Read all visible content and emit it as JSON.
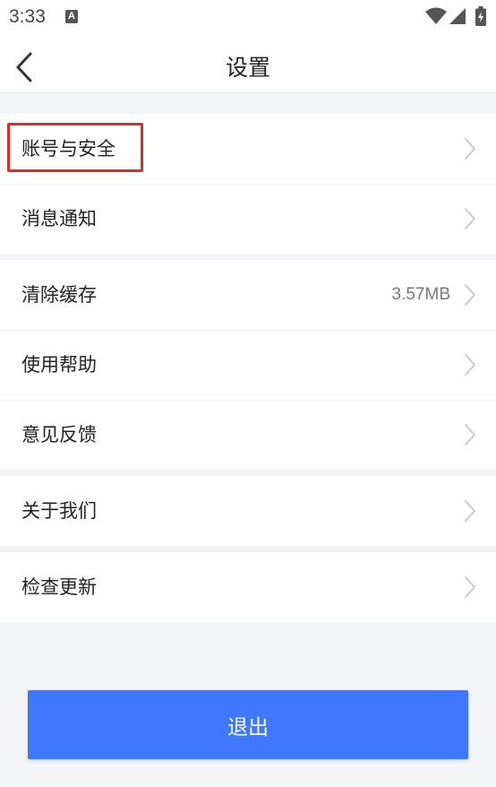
{
  "status_bar": {
    "time": "3:33",
    "notification_icon": "a-icon",
    "notification_letter": "A",
    "icons": [
      "wifi-icon",
      "signal-icon",
      "battery-icon"
    ]
  },
  "header": {
    "back_icon": "chevron-left-icon",
    "title": "设置"
  },
  "settings": {
    "groups": [
      {
        "items": [
          {
            "label": "账号与安全",
            "value": "",
            "icon": "chevron-right-icon",
            "highlighted": true
          },
          {
            "label": "消息通知",
            "value": "",
            "icon": "chevron-right-icon"
          }
        ]
      },
      {
        "items": [
          {
            "label": "清除缓存",
            "value": "3.57MB",
            "icon": "chevron-right-icon"
          },
          {
            "label": "使用帮助",
            "value": "",
            "icon": "chevron-right-icon"
          },
          {
            "label": "意见反馈",
            "value": "",
            "icon": "chevron-right-icon"
          }
        ]
      },
      {
        "items": [
          {
            "label": "关于我们",
            "value": "",
            "icon": "chevron-right-icon"
          }
        ]
      },
      {
        "items": [
          {
            "label": "检查更新",
            "value": "",
            "icon": "chevron-right-icon"
          }
        ]
      }
    ]
  },
  "footer": {
    "logout_label": "退出"
  },
  "colors": {
    "accent": "#3f78ff",
    "highlight": "#e02a2a",
    "background": "#f2f4f7"
  }
}
